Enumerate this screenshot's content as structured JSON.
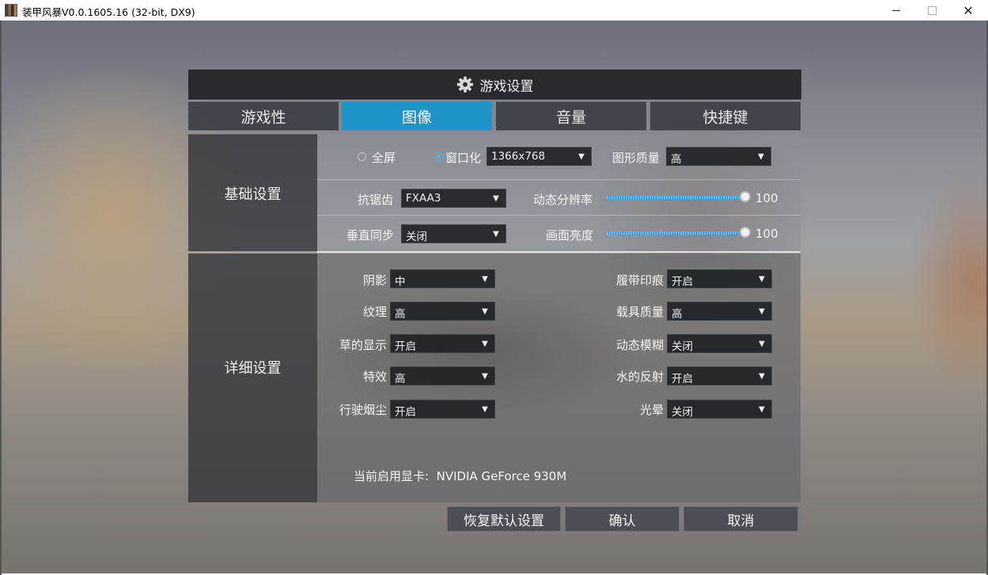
{
  "window": {
    "title": "装甲风暴V0.0.1605.16 (32-bit, DX9)",
    "close_glyph": "✕"
  },
  "panel": {
    "title": "游戏设置",
    "tabs": [
      {
        "label": "游戏性",
        "active": false
      },
      {
        "label": "图像",
        "active": true
      },
      {
        "label": "音量",
        "active": false
      },
      {
        "label": "快捷键",
        "active": false
      }
    ]
  },
  "basic": {
    "section_label": "基础设置",
    "fullscreen_label": "全屏",
    "windowed_label": "窗口化",
    "display_mode_selected": "windowed",
    "resolution": "1366x768",
    "graphics_quality_label": "图形质量",
    "graphics_quality": "高",
    "antialiasing_label": "抗锯齿",
    "antialiasing": "FXAA3",
    "dynamic_resolution_label": "动态分辨率",
    "dynamic_resolution": 100,
    "vsync_label": "垂直同步",
    "vsync": "关闭",
    "brightness_label": "画面亮度",
    "brightness": 100
  },
  "detail": {
    "section_label": "详细设置",
    "left": [
      {
        "label": "阴影",
        "value": "中"
      },
      {
        "label": "纹理",
        "value": "高"
      },
      {
        "label": "草的显示",
        "value": "开启"
      },
      {
        "label": "特效",
        "value": "高"
      },
      {
        "label": "行驶烟尘",
        "value": "开启"
      }
    ],
    "right": [
      {
        "label": "履带印痕",
        "value": "开启"
      },
      {
        "label": "载具质量",
        "value": "高"
      },
      {
        "label": "动态模糊",
        "value": "关闭"
      },
      {
        "label": "水的反射",
        "value": "开启"
      },
      {
        "label": "光晕",
        "value": "关闭"
      }
    ],
    "gpu_label": "当前启用显卡:",
    "gpu_name": "NVIDIA GeForce 930M"
  },
  "buttons": {
    "restore_defaults": "恢复默认设置",
    "confirm": "确认",
    "cancel": "取消"
  },
  "colors": {
    "accent": "#1e94c8",
    "slider": "#4fb5e8"
  }
}
